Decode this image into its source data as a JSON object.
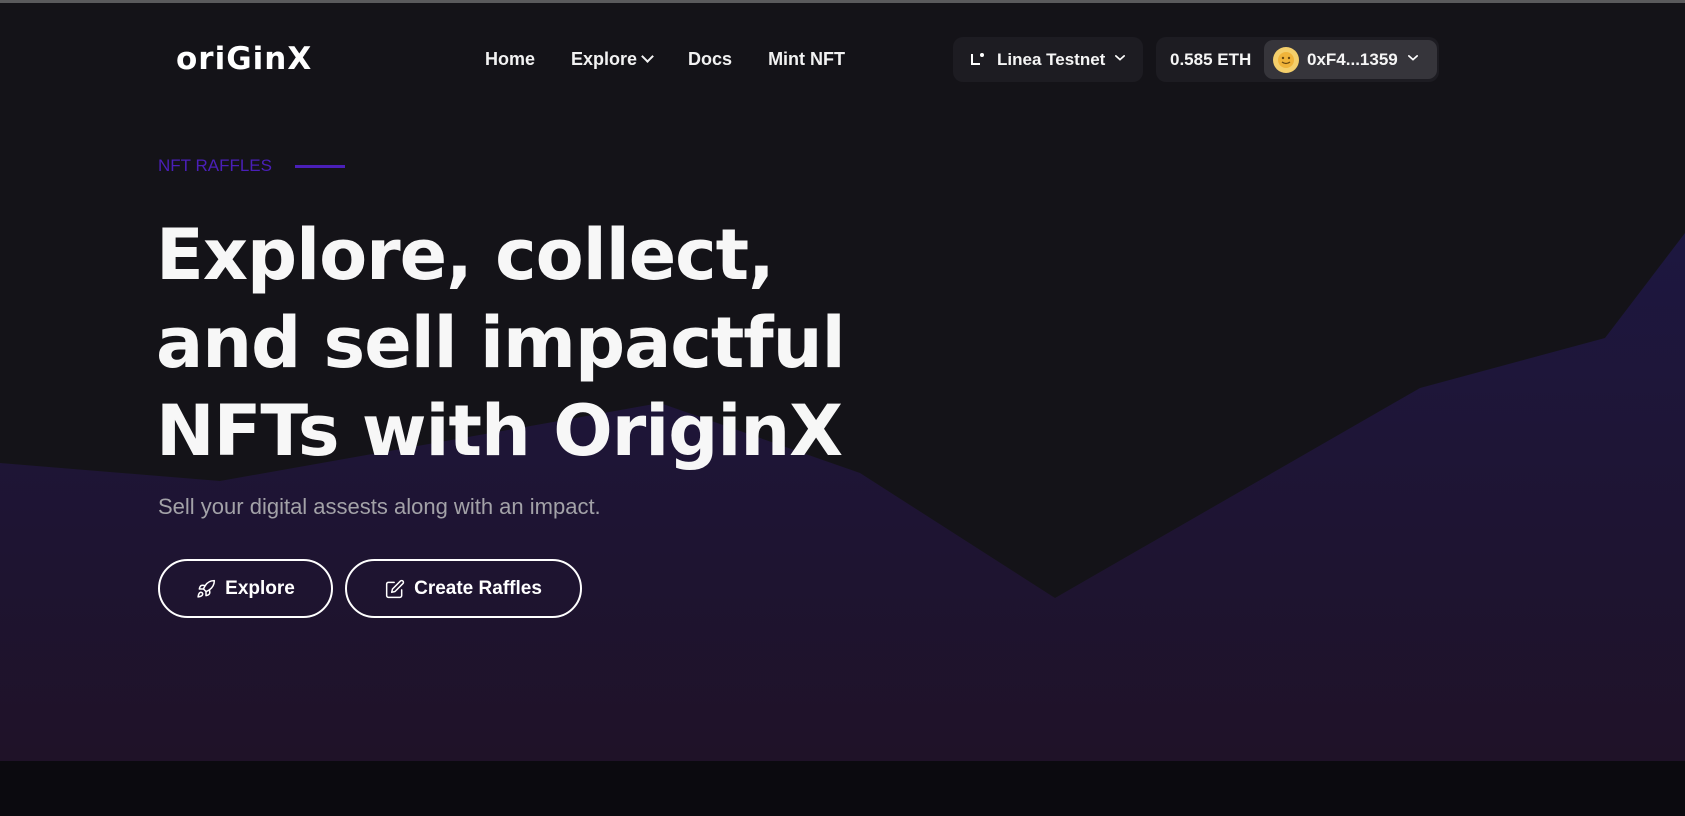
{
  "header": {
    "logo_text": "oriGinX",
    "nav_items": [
      {
        "label": "Home"
      },
      {
        "label": "Explore"
      },
      {
        "label": "Docs"
      },
      {
        "label": "Mint NFT"
      }
    ],
    "network": {
      "label": "Linea Testnet",
      "icon": "linea-icon"
    },
    "wallet": {
      "balance": "0.585 ETH",
      "address": "0xF4...1359",
      "avatar_icon": "avatar-emoji-icon"
    }
  },
  "hero": {
    "eyebrow": "NFT RAFFLES",
    "headline": "Explore, collect, and sell impactful NFTs with OriginX",
    "subtitle": "Sell your digital assests along with an impact.",
    "buttons": [
      {
        "label": "Explore",
        "icon": "rocket-icon"
      },
      {
        "label": "Create Raffles",
        "icon": "edit-icon"
      }
    ]
  },
  "colors": {
    "background": "#141318",
    "accent": "#4a1fb8",
    "wave": "#1c1638",
    "text": "#f7f7f7",
    "muted": "#a3a2a8"
  }
}
